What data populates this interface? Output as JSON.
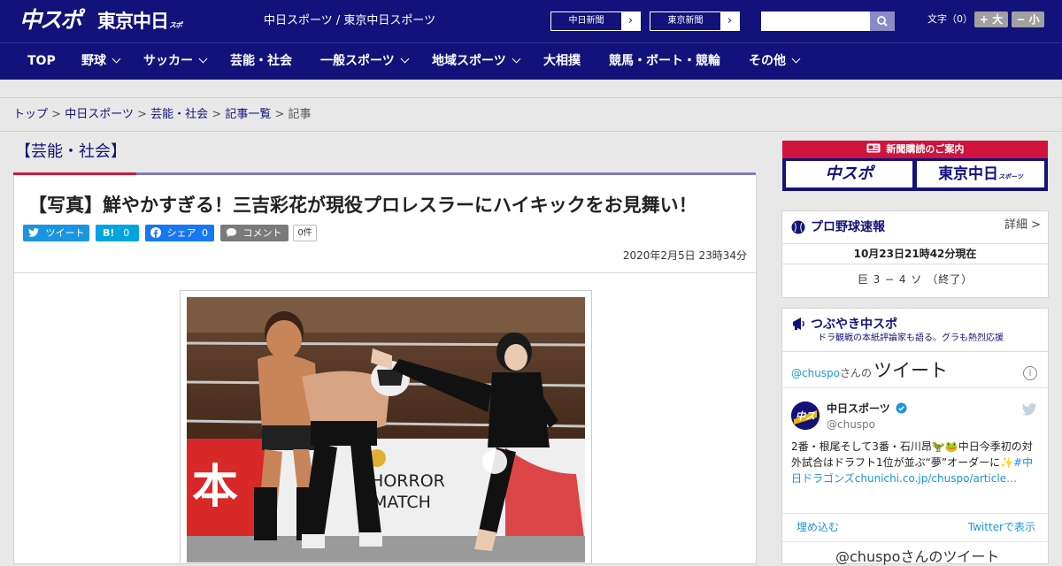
{
  "header": {
    "logo_chuspo": "中スポ",
    "logo_tokyo": "東京中日",
    "logo_tokyo_small": "スポーツ",
    "site_links": "中日スポーツ / 東京中日スポーツ",
    "ext_buttons": [
      "中日新聞",
      "東京新聞"
    ],
    "font_size_label": "文字（0）",
    "font_larger": "+ 大",
    "font_smaller": "− 小"
  },
  "nav": {
    "items": [
      "TOP",
      "野球",
      "サッカー",
      "芸能・社会",
      "一般スポーツ",
      "地域スポーツ",
      "大相撲",
      "競馬・ボート・競輪",
      "その他"
    ]
  },
  "breadcrumb": {
    "items": [
      "トップ",
      "中日スポーツ",
      "芸能・社会",
      "記事一覧"
    ],
    "current": "記事",
    "separator": ">"
  },
  "article": {
    "category": "【芸能・社会】",
    "headline": "【写真】鮮やかすぎる！三吉彩花が現役プロレスラーにハイキックをお見舞い！",
    "share": {
      "twitter": "ツイート",
      "hatena": "B!",
      "hatena_count": "0",
      "facebook": "シェア",
      "facebook_count": "0",
      "comment": "コメント",
      "comment_count": "0件"
    },
    "date": "2020年2月5日 23時34分",
    "photo_banner_1": "本",
    "photo_banner_2": "E HORROR",
    "photo_banner_3": "MATCH"
  },
  "sidebar": {
    "promo_title": "新聞購読のご案内",
    "promo_left": "中スポ",
    "promo_right": "東京中日",
    "promo_right_small": "スポーツ",
    "baseball": {
      "title": "プロ野球速報",
      "detail": "詳細 >",
      "time": "10月23日21時42分現在",
      "game": "巨 3 − 4 ソ （終了）"
    },
    "twitter": {
      "title": "つぶやき中スポ",
      "subtitle": "ドラ観戦の本紙評論家も語る。グラも熱烈応援",
      "handle": "@chuspo",
      "san": "さんの",
      "tweet_word": "ツイート",
      "name": "中日スポーツ",
      "user": "@chuspo",
      "text_1": "2番・根尾そして3番・石川昂🦖🐸中日今季初の対外試合はドラフト1位が並ぶ“夢”オーダーに✨",
      "text_hashtag": "#中日ドラゴンズ",
      "text_link": "chunichi.co.jp/chuspo/article…",
      "embed": "埋め込む",
      "view_on_twitter": "Twitterで表示",
      "more": "@chuspoさんのツイート"
    }
  },
  "colors": {
    "brand_navy": "#13127a",
    "accent_red": "#d0143c",
    "twitter_blue": "#1b95e0",
    "hatena_blue": "#00a4de",
    "facebook_blue": "#1877f2",
    "comment_gray": "#7a7a7a"
  },
  "icons": [
    "search-icon",
    "chevron-down-icon",
    "chevron-right-icon",
    "twitter-bird-icon",
    "facebook-icon",
    "comment-icon",
    "baseball-icon",
    "megaphone-icon",
    "info-icon",
    "verified-badge-icon",
    "newspaper-icon"
  ]
}
